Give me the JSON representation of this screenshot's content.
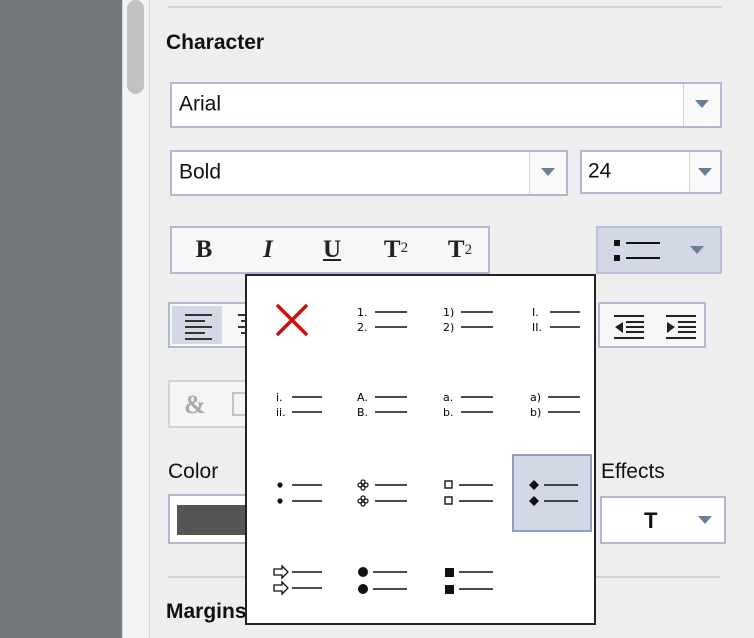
{
  "section": {
    "title": "Character"
  },
  "font_family": {
    "value": "Arial"
  },
  "font_style": {
    "value": "Bold"
  },
  "font_size": {
    "value": "24"
  },
  "format_buttons": {
    "bold": "B",
    "italic": "I",
    "underline": "U",
    "superscript_base": "T",
    "superscript_sup": "2",
    "subscript_base": "T",
    "subscript_sub": "2"
  },
  "insert_special": {
    "label": "&"
  },
  "color": {
    "label": "Color",
    "swatch": "#545654"
  },
  "effects": {
    "label": "Effects",
    "value": "T"
  },
  "margins": {
    "label": "Margins"
  },
  "list_popup": {
    "selected": "diamond-bullets",
    "options": [
      {
        "id": "none"
      },
      {
        "id": "numbers",
        "m1": "1.",
        "m2": "2."
      },
      {
        "id": "numbers-paren",
        "m1": "1)",
        "m2": "2)"
      },
      {
        "id": "roman-upper",
        "m1": "I.",
        "m2": "II."
      },
      {
        "id": "roman-lower",
        "m1": "i.",
        "m2": "ii."
      },
      {
        "id": "alpha-upper",
        "m1": "A.",
        "m2": "B."
      },
      {
        "id": "alpha-lower",
        "m1": "a.",
        "m2": "b."
      },
      {
        "id": "alpha-lower-paren",
        "m1": "a)",
        "m2": "b)"
      },
      {
        "id": "small-dot-bullets"
      },
      {
        "id": "star-bullets"
      },
      {
        "id": "hollow-square-bullets"
      },
      {
        "id": "diamond-bullets"
      },
      {
        "id": "arrow-bullets"
      },
      {
        "id": "large-dot-bullets"
      },
      {
        "id": "filled-square-bullets"
      }
    ]
  },
  "colors": {
    "accent_border": "#b1b8cf",
    "selection_fill": "#d2d8e6",
    "delete_red": "#cc1111"
  }
}
